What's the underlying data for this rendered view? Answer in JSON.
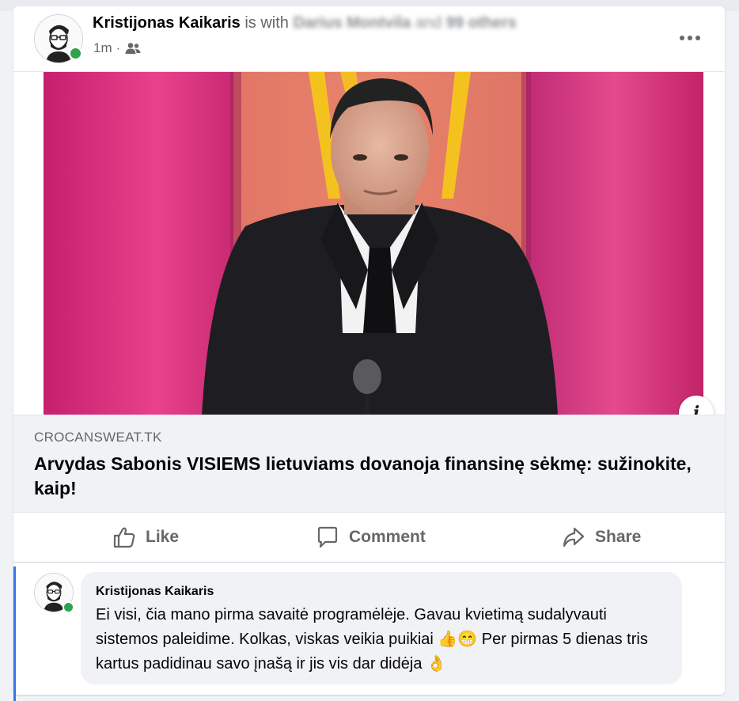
{
  "post": {
    "author_name": "Kristijonas Kaikaris",
    "with_text": "is with",
    "tagged_blurred": "Darius Montvila",
    "and_text": "and",
    "others_blurred": "99 others",
    "time": "1m",
    "separator": "·",
    "audience_icon": "friends-icon",
    "more_icon": "more-horizontal-icon"
  },
  "link_preview": {
    "domain": "CROCANSWEAT.TK",
    "title": "Arvydas Sabonis VISIEMS lietuviams dovanoja finansinę sėkmę: sužinokite, kaip!",
    "info_label": "i"
  },
  "actions": {
    "like": "Like",
    "comment": "Comment",
    "share": "Share"
  },
  "comment": {
    "author": "Kristijonas Kaikaris",
    "text": "Ei visi, čia mano pirma savaitė programėlėje. Gavau kvietimą sudalyvauti sistemos paleidime. Kolkas, viskas veikia puikiai 👍😁 Per pirmas 5 dienas tris kartus padidinau savo įnašą ir jis vis dar didėja 👌"
  },
  "colors": {
    "accent": "#3578e5",
    "online": "#31a24c",
    "text_secondary": "#65676b",
    "backdrop_pink": "#d8337a"
  }
}
